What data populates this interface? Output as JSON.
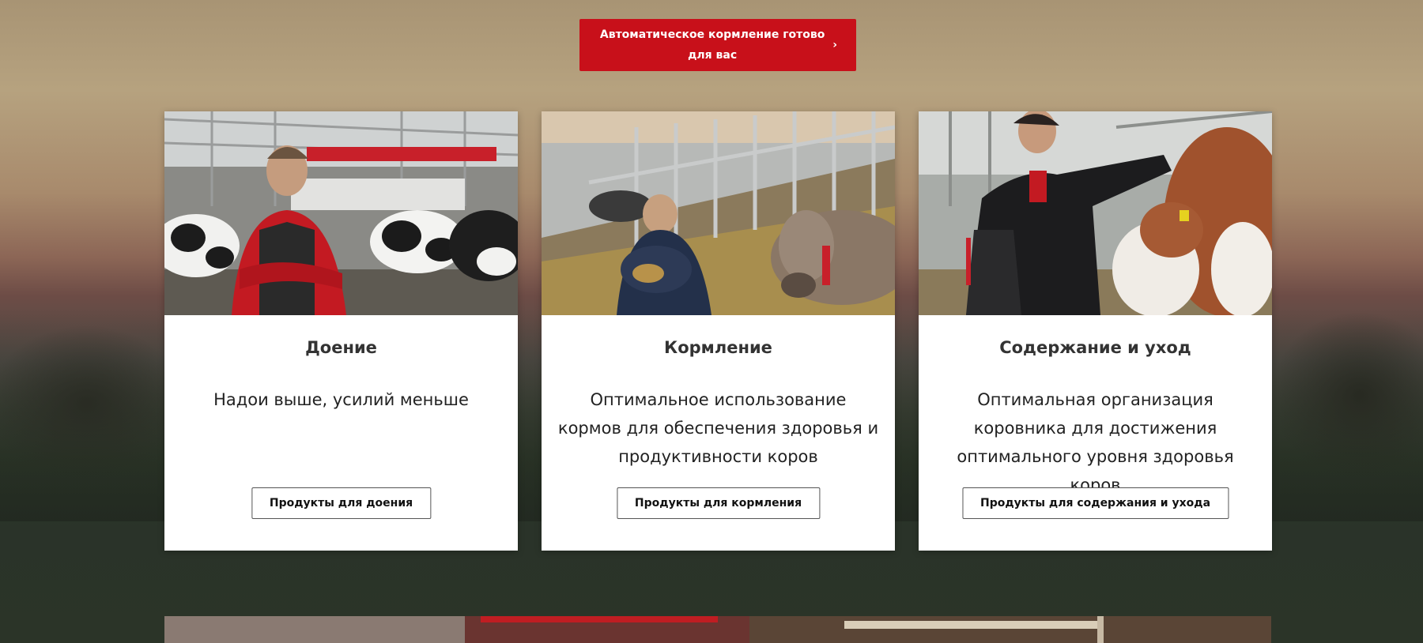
{
  "cta": {
    "label": "Автоматическое кормление готово для вас",
    "chevron_icon": "chevron-right-icon",
    "color": "#c8101a"
  },
  "cards": [
    {
      "title": "Доение",
      "text": "Надои выше, усилий меньше",
      "button": "Продукты для доения",
      "image": "milking-barn-photo"
    },
    {
      "title": "Кормление",
      "text": "Оптимальное использование кормов для обеспечения здоровья и продуктивности коров",
      "button": "Продукты для кормления",
      "image": "feeding-barn-photo"
    },
    {
      "title": "Содержание и уход",
      "text": "Оптимальная организация коровника для достижения оптимального уровня здоровья коров",
      "button": "Продукты для содержания и ухода",
      "image": "care-barn-photo"
    }
  ],
  "bottom_section": {
    "image": "barn-interior-photo"
  }
}
